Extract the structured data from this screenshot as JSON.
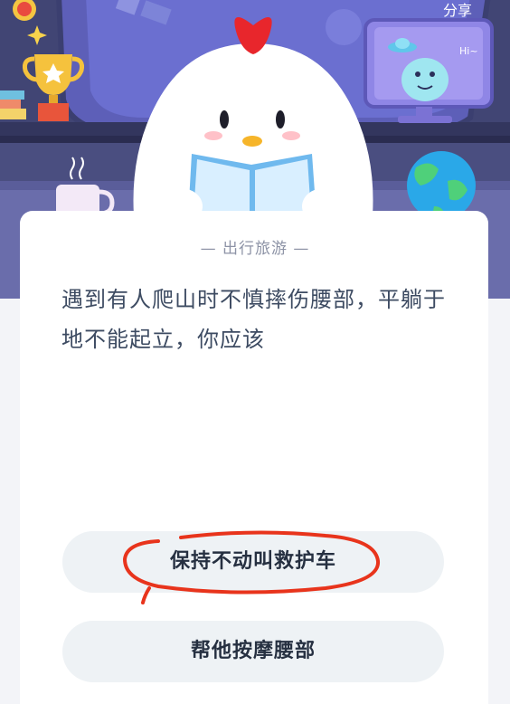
{
  "header": {
    "share_label": "分享",
    "bubble_text": "Hi~"
  },
  "card": {
    "category": "— 出行旅游 —",
    "question": "遇到有人爬山时不慎摔伤腰部，平躺于地不能起立，你应该"
  },
  "options": [
    {
      "label": "保持不动叫救护车",
      "hand_circled": true
    },
    {
      "label": "帮他按摩腰部",
      "hand_circled": false
    }
  ],
  "colors": {
    "scene_bg": "#4b4f82",
    "card_bg": "#ffffff",
    "option_bg": "#eef2f5",
    "question_text": "#3d4b62",
    "circle_stroke": "#e8341c"
  }
}
